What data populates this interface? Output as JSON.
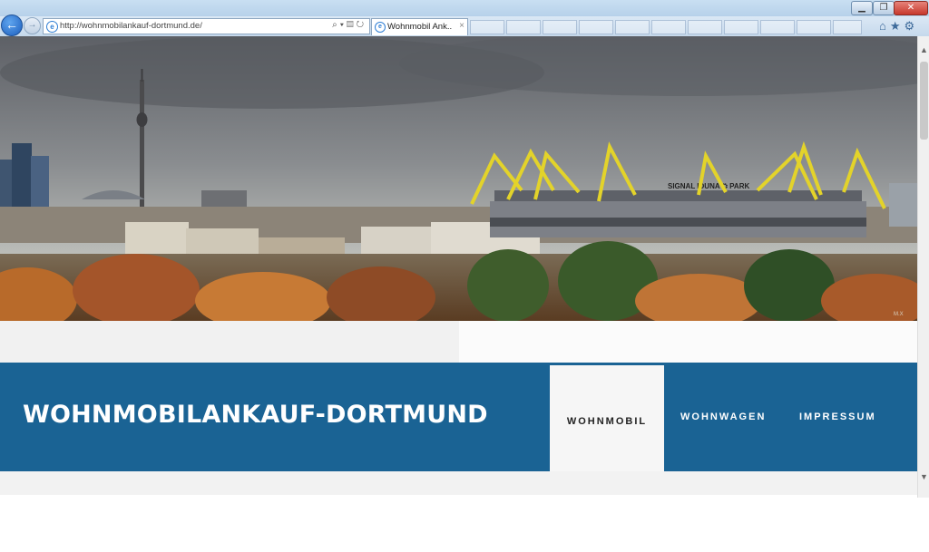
{
  "browser": {
    "address_url": "http://wohnmobilankauf-dortmund.de/",
    "tab_title": "Wohnmobil Ank...",
    "tab_close": "×",
    "window_buttons": {
      "minimize": "▁",
      "maximize": "❐",
      "close": "✕"
    },
    "icons": [
      "back-icon",
      "forward-icon",
      "ie-logo-icon",
      "search-icon",
      "compatibility-icon",
      "refresh-icon",
      "home-icon",
      "favorites-star-icon",
      "settings-gear-icon"
    ]
  },
  "hero": {
    "stadium_sign": "SIGNAL IDUNA ⛭ PARK",
    "watermark": "M.X"
  },
  "site": {
    "title": "WOHNMOBILANKAUF-DORTMUND",
    "nav": [
      {
        "label": "WOHNMOBIL",
        "active": true
      },
      {
        "label": "WOHNWAGEN",
        "active": false
      },
      {
        "label": "IMPRESSUM",
        "active": false
      }
    ]
  },
  "colors": {
    "header_blue": "#1a6394",
    "stadium_yellow": "#e3d32a",
    "nav_active_bg": "#f6f6f6"
  }
}
